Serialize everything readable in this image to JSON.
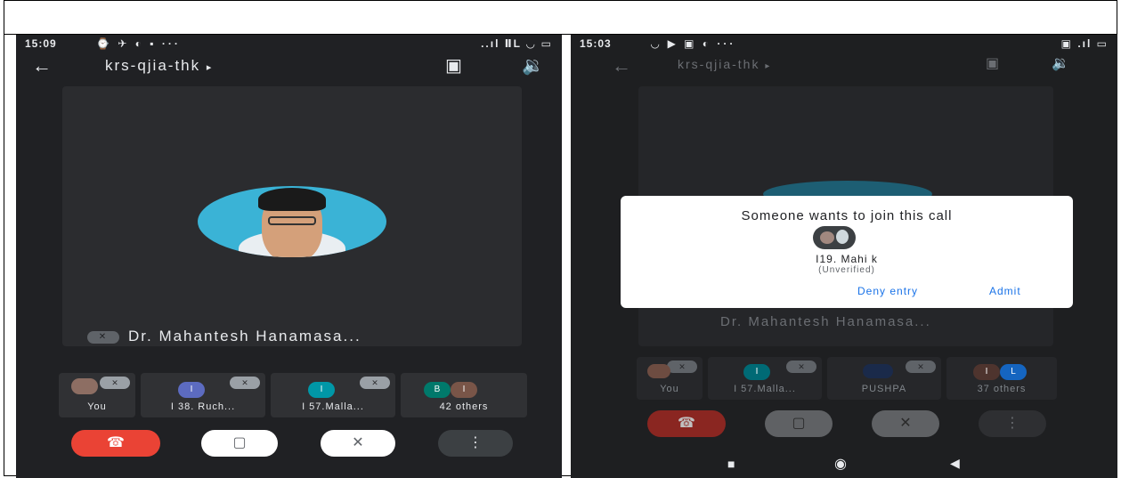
{
  "left_phone": {
    "status": {
      "time": "15:09",
      "icons": "⌚ ✈ ◐ ▪ ···",
      "right": "..ıl ⅡL ◡ ▭"
    },
    "meeting_code": "krs-qjia-thk",
    "expand_glyph": "▸",
    "speaker_name": "Dr. Mahantesh Hanamasa...",
    "participants": [
      {
        "label": "You"
      },
      {
        "label": "I 38. Ruch...",
        "chip": "I",
        "chip_color": "#5c6bc0"
      },
      {
        "label": "I 57.Malla...",
        "chip": "I",
        "chip_color": "#0097a7"
      },
      {
        "label": "42 others",
        "chips": [
          "B",
          "I"
        ],
        "chip_colors": [
          "#00796b",
          "#795548"
        ]
      }
    ]
  },
  "right_phone": {
    "status": {
      "time": "15:03",
      "icons": "◡ ▶ ▣ ◐ ···",
      "right": "▣ .ıl ▭"
    },
    "meeting_code": "krs-qjia-thk",
    "expand_glyph": "▸",
    "speaker_name": "Dr. Mahantesh Hanamasa...",
    "dialog": {
      "title": "Someone wants to join this call",
      "requester_name": "I19. Mahi k",
      "requester_status": "(Unverified)",
      "deny_label": "Deny entry",
      "admit_label": "Admit"
    },
    "participants": [
      {
        "label": "You"
      },
      {
        "label": "I 57.Malla...",
        "chip": "I",
        "chip_color": "#0097a7"
      },
      {
        "label": "PUSHPA"
      },
      {
        "label": "37 others",
        "chips": [
          "I",
          "L"
        ],
        "chip_colors": [
          "#795548",
          "#1976d2"
        ]
      }
    ]
  },
  "icons": {
    "back": "back-arrow-icon",
    "camera_switch": "camera-switch-icon",
    "speaker": "speaker-icon",
    "mic_off": "mic-off-icon",
    "end_call": "end-call-icon",
    "camera_off": "camera-off-icon",
    "more": "more-options-icon"
  },
  "colors": {
    "end_call": "#ea4335",
    "link": "#1a73e8",
    "avatar_bg": "#3ab3d6"
  }
}
